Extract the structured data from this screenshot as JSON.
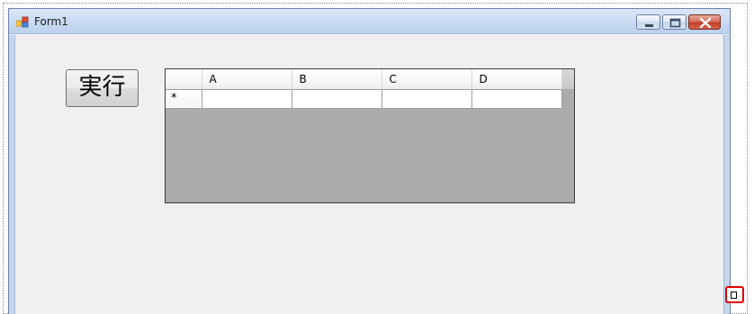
{
  "window": {
    "title": "Form1",
    "icon": "winforms-app-icon",
    "controls": [
      "minimize-icon",
      "maximize-icon",
      "close-icon"
    ]
  },
  "run_button": {
    "label": "実行"
  },
  "grid": {
    "columns": [
      "A",
      "B",
      "C",
      "D"
    ],
    "new_row_marker": "*",
    "new_row_cells": [
      "",
      "",
      "",
      ""
    ]
  },
  "colors": {
    "titlebar": "#c9daf2",
    "client_background": "#f0f0f0",
    "grid_background": "#ababab",
    "close_button": "#c2412b",
    "highlight_box": "#e00000"
  }
}
